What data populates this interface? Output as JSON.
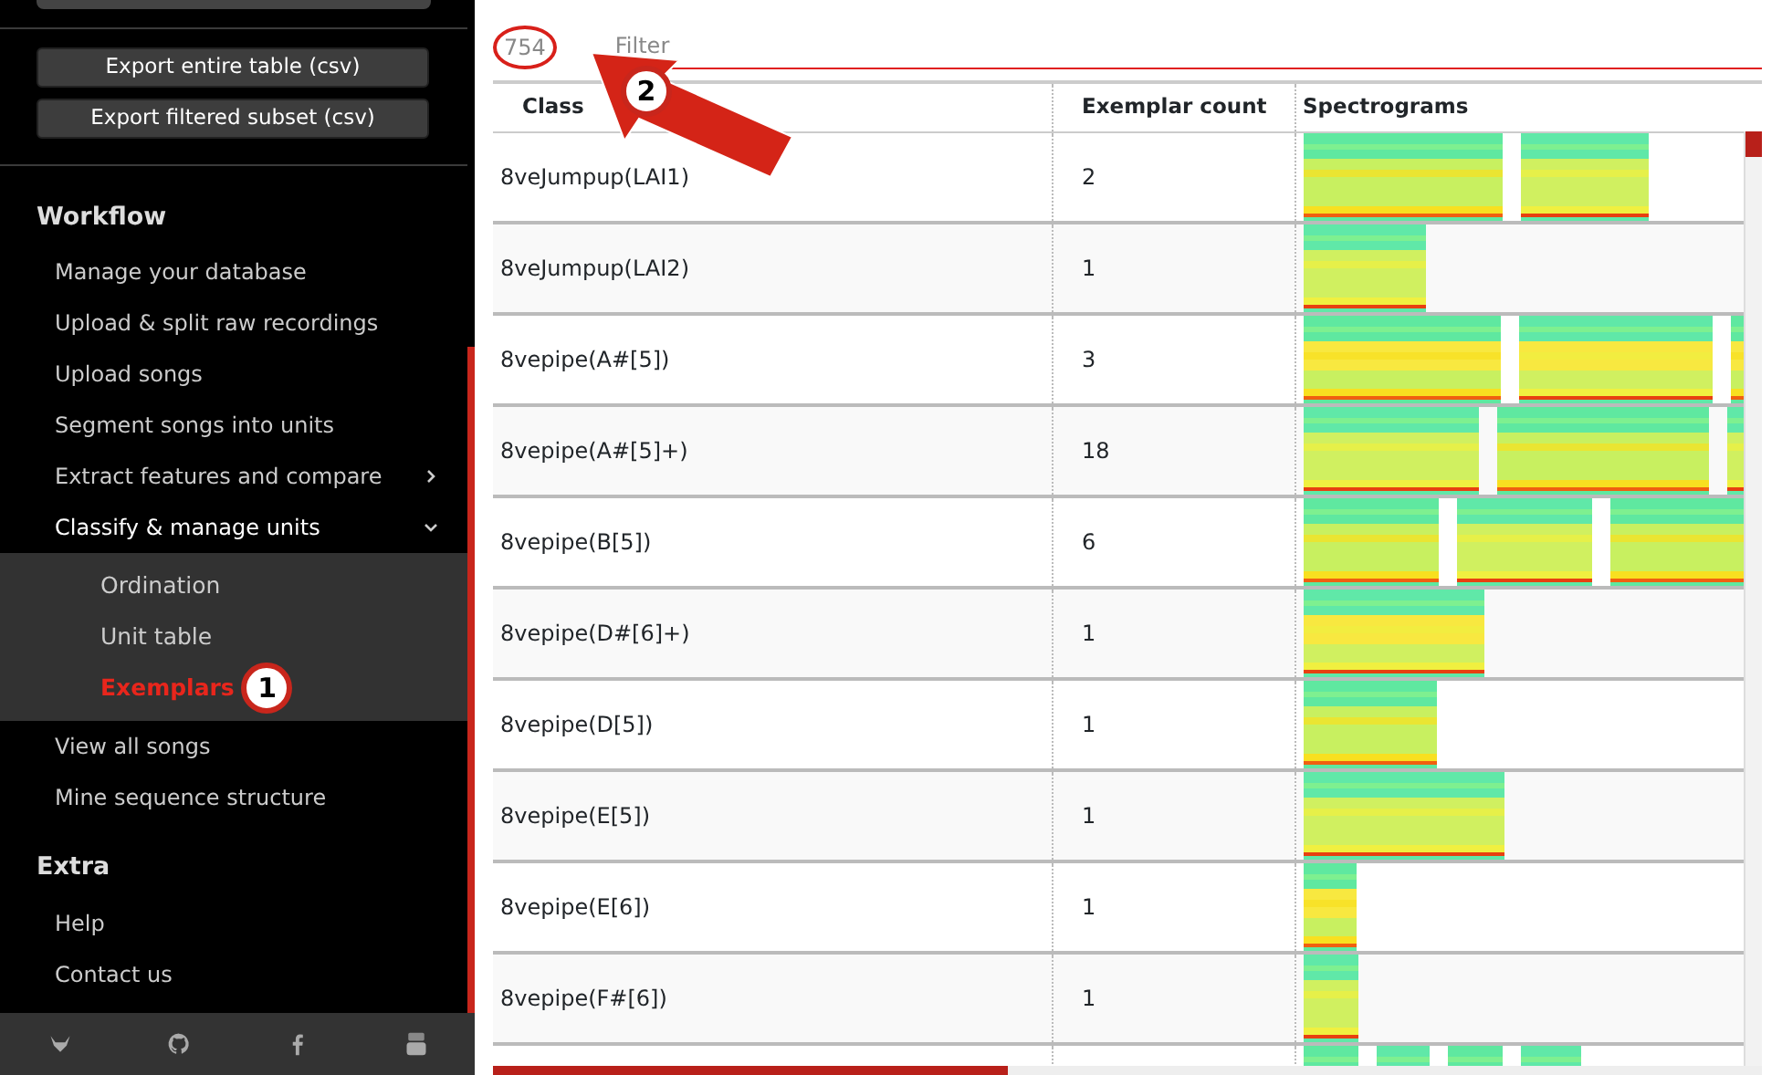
{
  "sidebar": {
    "export_buttons": [
      "Export entire table (csv)",
      "Export filtered subset (csv)"
    ],
    "sections": [
      {
        "title": "Workflow",
        "items": [
          {
            "label": "Manage your database"
          },
          {
            "label": "Upload & split raw recordings"
          },
          {
            "label": "Upload songs"
          },
          {
            "label": "Segment songs into units"
          },
          {
            "label": "Extract features and compare",
            "expanded": false
          },
          {
            "label": "Classify & manage units",
            "expanded": true,
            "children": [
              {
                "label": "Ordination",
                "selected": false
              },
              {
                "label": "Unit table",
                "selected": false
              },
              {
                "label": "Exemplars",
                "selected": true,
                "callout": "1"
              }
            ]
          },
          {
            "label": "View all songs"
          },
          {
            "label": "Mine sequence structure"
          }
        ]
      },
      {
        "title": "Extra",
        "items": [
          {
            "label": "Help"
          },
          {
            "label": "Contact us"
          }
        ]
      }
    ]
  },
  "toolbar": {
    "count": "754",
    "count_circled": true,
    "filter_placeholder": "Filter",
    "callout": "2"
  },
  "table": {
    "columns": [
      "Class",
      "Exemplar count",
      "Spectrograms"
    ],
    "rows": [
      {
        "class": "8veJumpup(LAI1)",
        "count": "2",
        "spectrograms": [
          {
            "kind": "picture"
          },
          {
            "kind": "picture"
          }
        ]
      },
      {
        "class": "8veJumpup(LAI2)",
        "count": "1",
        "spectrograms": [
          {
            "kind": "picture"
          }
        ]
      },
      {
        "class": "8vepipe(A#[5])",
        "count": "3",
        "spectrograms": [
          {
            "kind": "picture"
          },
          {
            "kind": "picture"
          },
          {
            "kind": "picture"
          }
        ]
      },
      {
        "class": "8vepipe(A#[5]+)",
        "count": "18",
        "spectrograms": [
          {
            "kind": "picture"
          },
          {
            "kind": "picture"
          },
          {
            "kind": "picture"
          }
        ]
      },
      {
        "class": "8vepipe(B[5])",
        "count": "6",
        "spectrograms": [
          {
            "kind": "picture"
          },
          {
            "kind": "picture"
          },
          {
            "kind": "picture"
          }
        ]
      },
      {
        "class": "8vepipe(D#[6]+)",
        "count": "1",
        "spectrograms": [
          {
            "kind": "picture"
          }
        ]
      },
      {
        "class": "8vepipe(D[5])",
        "count": "1",
        "spectrograms": [
          {
            "kind": "picture"
          }
        ]
      },
      {
        "class": "8vepipe(E[5])",
        "count": "1",
        "spectrograms": [
          {
            "kind": "picture"
          }
        ]
      },
      {
        "class": "8vepipe(E[6])",
        "count": "1",
        "spectrograms": [
          {
            "kind": "picture"
          }
        ]
      },
      {
        "class": "8vepipe(F#[6])",
        "count": "1",
        "spectrograms": [
          {
            "kind": "picture"
          }
        ]
      },
      {
        "spectrograms": [
          {
            "kind": "picture"
          },
          {
            "kind": "picture"
          },
          {
            "kind": "picture"
          },
          {
            "kind": "picture"
          }
        ]
      }
    ]
  }
}
